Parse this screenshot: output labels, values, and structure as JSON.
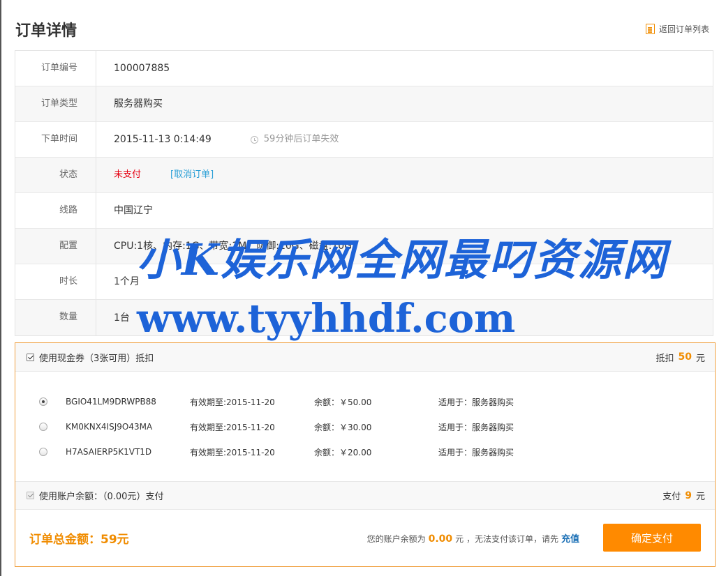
{
  "page": {
    "title": "订单详情",
    "back_label": "返回订单列表"
  },
  "order": {
    "rows": [
      {
        "label": "订单编号",
        "value": "100007885"
      },
      {
        "label": "订单类型",
        "value": "服务器购买"
      },
      {
        "label": "下单时间",
        "value": "2015-11-13 0:14:49",
        "tip": "59分钟后订单失效"
      },
      {
        "label": "状态",
        "value": "未支付",
        "action": "[取消订单]"
      },
      {
        "label": "线路",
        "value": "中国辽宁"
      },
      {
        "label": "配置",
        "value": "CPU:1核、内存:1G、带宽:1M、防御:10G、磁盘:10G"
      },
      {
        "label": "时长",
        "value": "1个月"
      },
      {
        "label": "数量",
        "value": "1台"
      }
    ]
  },
  "coupon": {
    "use_label": "使用现金券（3张可用）抵扣",
    "deduct_prefix": "抵扣",
    "deduct_amount": "50",
    "deduct_unit": "元",
    "items": [
      {
        "code": "BGIO41LM9DRWPB88",
        "expiry": "有效期至:2015-11-20",
        "balance": "余额：￥50.00",
        "scope": "适用于：服务器购买",
        "selected": true
      },
      {
        "code": "KM0KNX4ISJ9O43MA",
        "expiry": "有效期至:2015-11-20",
        "balance": "余额：￥30.00",
        "scope": "适用于：服务器购买",
        "selected": false
      },
      {
        "code": "H7ASAIERP5K1VT1D",
        "expiry": "有效期至:2015-11-20",
        "balance": "余额：￥20.00",
        "scope": "适用于：服务器购买",
        "selected": false
      }
    ]
  },
  "balance": {
    "use_label": "使用账户余额：（0.00元）支付",
    "pay_prefix": "支付",
    "pay_amount": "9",
    "pay_unit": "元"
  },
  "footer": {
    "total": "订单总金额：59元",
    "tip_prefix": "您的账户余额为",
    "tip_balance": "0.00",
    "tip_suffix": "元 ，无法支付该订单，请先",
    "recharge": "充值",
    "confirm": "确定支付"
  },
  "watermark": {
    "line1": "小K娱乐网全网最叼资源网",
    "line2": "www.tyyhhdf.com"
  },
  "colors": {
    "accent": "#ff8a00",
    "border": "#f0a040",
    "link": "#2a9fd6",
    "danger": "#e60012"
  }
}
